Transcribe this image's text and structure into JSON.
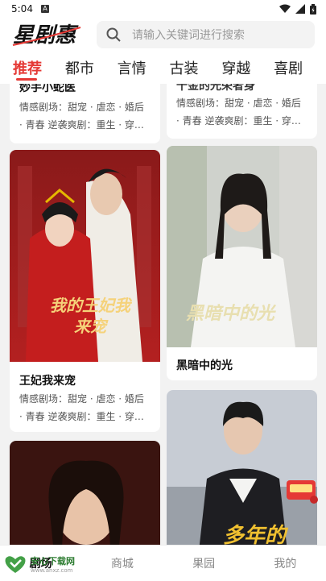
{
  "status_bar": {
    "time": "5:04"
  },
  "header": {
    "logo_text": "星剧惠",
    "search_placeholder": "请输入关键词进行搜索"
  },
  "tabs": [
    {
      "label": "推荐",
      "active": true
    },
    {
      "label": "都市",
      "active": false
    },
    {
      "label": "言情",
      "active": false
    },
    {
      "label": "古装",
      "active": false
    },
    {
      "label": "穿越",
      "active": false
    },
    {
      "label": "喜剧",
      "active": false
    }
  ],
  "cards": [
    {
      "title": "妙手小蛇医",
      "tags_line1": "情感剧场：甜宠 · 虐恋 · 婚后",
      "tags_line2": "· 青春 逆袭爽剧：重生 · 穿…"
    },
    {
      "title": "千金的光荣者身",
      "tags_line1": "情感剧场：甜宠 · 虐恋 · 婚后",
      "tags_line2": "· 青春 逆袭爽剧：重生 · 穿…"
    },
    {
      "title": "王妃我来宠",
      "poster_caption": "我的王妃我来宠",
      "tags_line1": "情感剧场：甜宠 · 虐恋 · 婚后",
      "tags_line2": "· 青春 逆袭爽剧：重生 · 穿…"
    },
    {
      "title": "黑暗中的光",
      "poster_caption": "黑暗中的光"
    },
    {
      "title": "",
      "poster_caption": ""
    },
    {
      "title": "",
      "poster_caption": "多年的"
    }
  ],
  "bottom_nav": [
    {
      "label": "剧场",
      "active": true
    },
    {
      "label": "商城",
      "active": false
    },
    {
      "label": "果园",
      "active": false
    },
    {
      "label": "我的",
      "active": false
    }
  ],
  "watermark": {
    "text": "安心下载网",
    "url": "www.anxz.com"
  },
  "colors": {
    "accent": "#e53935",
    "background": "#f2f2f2"
  }
}
